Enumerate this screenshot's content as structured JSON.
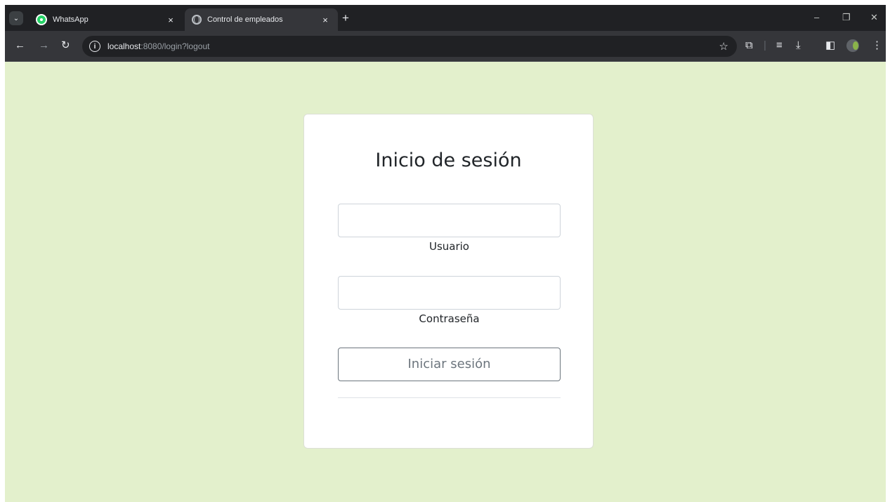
{
  "browser": {
    "tabs": [
      {
        "title": "WhatsApp",
        "icon": "whatsapp-icon",
        "active": false
      },
      {
        "title": "Control de empleados",
        "icon": "globe-icon",
        "active": true
      }
    ],
    "tab_close_glyph": "×",
    "new_tab_glyph": "+",
    "tab_search_glyph": "⌄",
    "address": {
      "host": "localhost",
      "rest": ":8080/login?logout"
    },
    "window_controls": {
      "minimize": "–",
      "restore": "❐",
      "close": "✕"
    },
    "nav": {
      "back": "←",
      "forward": "→",
      "reload": "↻",
      "info": "i",
      "bookmark": "☆"
    },
    "toolbar_icons": {
      "extensions": "⧉",
      "separator": "|",
      "media": "≡",
      "download": "⤓",
      "sidepanel": "◧",
      "menu": "⋮"
    }
  },
  "page": {
    "background": "#e3f0cc",
    "title": "Inicio de sesión",
    "username": {
      "value": "",
      "label": "Usuario"
    },
    "password": {
      "value": "",
      "label": "Contraseña"
    },
    "submit_label": "Iniciar sesión"
  }
}
